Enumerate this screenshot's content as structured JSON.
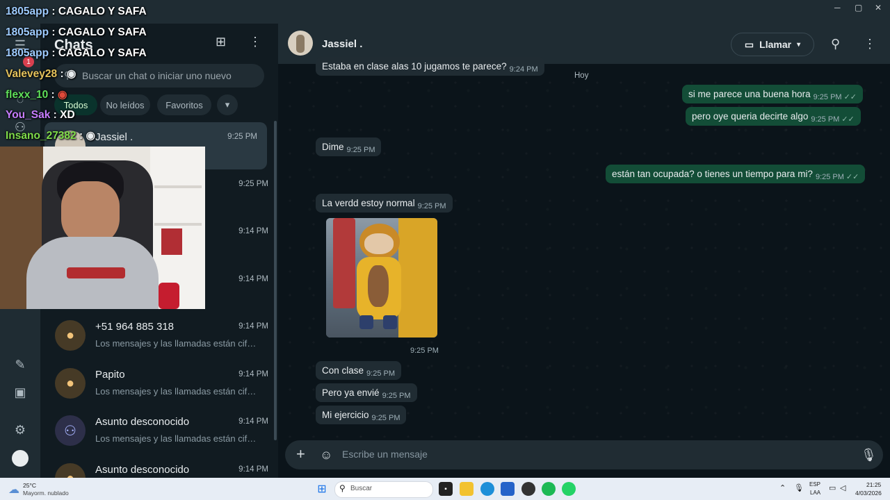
{
  "window": {
    "minimize": "─",
    "maximize": "▢",
    "close": "✕"
  },
  "sidebar": {
    "title": "Chats",
    "rail_badge": "1",
    "search_placeholder": "Buscar un chat o iniciar uno nuevo",
    "filters": [
      "Todos",
      "No leídos",
      "Favoritos"
    ],
    "chats": [
      {
        "name": "Jassiel .",
        "time": "9:25 PM",
        "preview": ""
      },
      {
        "name": "",
        "time": "9:25 PM",
        "preview": ""
      },
      {
        "name": "",
        "time": "9:14 PM",
        "preview": "s están cifr..."
      },
      {
        "name": "",
        "time": "9:14 PM",
        "preview": "están cifr..."
      },
      {
        "name": "+51 964 885 318",
        "time": "9:14 PM",
        "preview": "Los mensajes y las llamadas están cifr..."
      },
      {
        "name": "Papito",
        "time": "9:14 PM",
        "preview": "Los mensajes y las llamadas están cifr..."
      },
      {
        "name": "Asunto desconocido",
        "time": "9:14 PM",
        "preview": "Los mensajes y las llamadas están cifr..."
      },
      {
        "name": "Asunto desconocido",
        "time": "9:14 PM",
        "preview": ""
      }
    ]
  },
  "conversation": {
    "contact": "Jassiel .",
    "call_label": "Llamar",
    "day_label": "Hoy",
    "messages": [
      {
        "dir": "in",
        "text": "Estaba en clase alas 10 jugamos te parece?",
        "time": "9:24 PM"
      },
      {
        "dir": "out",
        "text": "si me parece una buena hora",
        "time": "9:25 PM"
      },
      {
        "dir": "out",
        "text": "pero oye queria decirte algo",
        "time": "9:25 PM"
      },
      {
        "dir": "in",
        "text": "Dime",
        "time": "9:25 PM"
      },
      {
        "dir": "out",
        "text": "están tan ocupada? o tienes un tiempo para mi?",
        "time": "9:25 PM"
      },
      {
        "dir": "in",
        "text": "La verdd estoy normal",
        "time": "9:25 PM"
      },
      {
        "dir": "in",
        "text": "Con clase",
        "time": "9:25 PM"
      },
      {
        "dir": "in",
        "text": "Pero ya envié",
        "time": "9:25 PM"
      },
      {
        "dir": "in",
        "text": "Mi ejercicio",
        "time": "9:25 PM"
      }
    ],
    "photo_time": "9:25 PM",
    "composer_placeholder": "Escribe un mensaje"
  },
  "stream_overlay": [
    {
      "user": "1805app",
      "text": "CAGALO Y SAFA",
      "color": "#9ecbff"
    },
    {
      "user": "1805app",
      "text": "CAGALO Y SAFA",
      "color": "#9ecbff"
    },
    {
      "user": "1805app",
      "text": "CAGALO Y SAFA",
      "color": "#9ecbff"
    },
    {
      "user": "Valevey28",
      "text": "",
      "color": "#e6c35c"
    },
    {
      "user": "flexx_10",
      "text": "",
      "color": "#5fe05a"
    },
    {
      "user": "You_Sak",
      "text": "XD",
      "color": "#c77dff"
    },
    {
      "user": "Insano_27382",
      "text": "",
      "color": "#7fdc4a"
    }
  ],
  "taskbar": {
    "weather_temp": "25°C",
    "weather_desc": "Mayorm. nublado",
    "search_label": "Buscar",
    "lang_top": "ESP",
    "lang_bottom": "LAA",
    "clock_time": "21:25",
    "clock_date": "4/03/2026"
  },
  "colors": {
    "accent": "#00a884",
    "outgoing": "#134d37",
    "incoming": "#202c33"
  }
}
